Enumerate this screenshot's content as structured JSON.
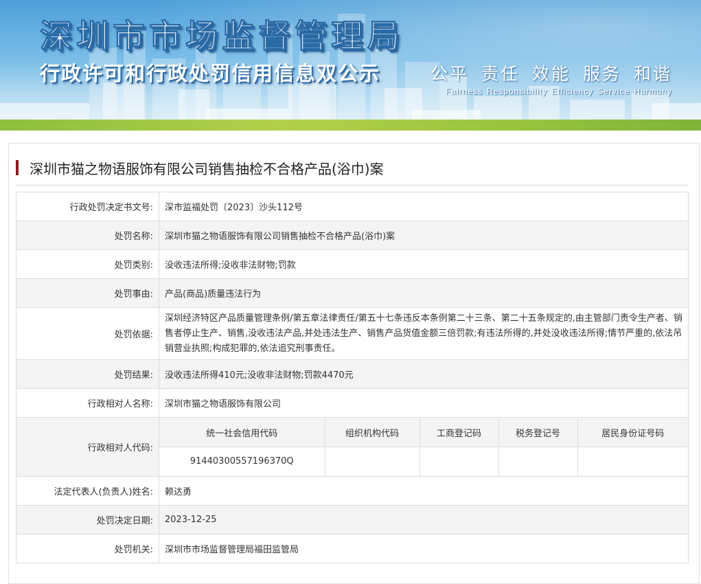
{
  "banner": {
    "title": "深圳市市场监督管理局",
    "subtitle": "行政许可和行政处罚信用信息双公示",
    "slogan_cn": [
      "公平",
      "责任",
      "效能",
      "服务",
      "和谐"
    ],
    "slogan_en": [
      "Fairness",
      "Responsibility",
      "Efficiency",
      "Service",
      "Harmony"
    ]
  },
  "case_title": "深圳市猫之物语服饰有限公司销售抽检不合格产品(浴巾)案",
  "fields": {
    "doc_no": {
      "label": "行政处罚决定书文号:",
      "value": "深市监福处罚〔2023〕沙头112号"
    },
    "name": {
      "label": "处罚名称:",
      "value": "深圳市猫之物语服饰有限公司销售抽检不合格产品(浴巾)案"
    },
    "category": {
      "label": "处罚类别:",
      "value": "没收违法所得;没收非法财物;罚款"
    },
    "reason": {
      "label": "处罚事由:",
      "value": "产品(商品)质量违法行为"
    },
    "basis": {
      "label": "处罚依据:",
      "value": "深圳经济特区产品质量管理条例/第五章法律责任/第五十七条违反本条例第二十三条、第二十五条规定的,由主管部门责令生产者、销售者停止生产、销售,没收违法产品,并处违法生产、销售产品货值金额三倍罚款;有违法所得的,并处没收违法所得;情节严重的,依法吊销营业执照;构成犯罪的,依法追究刑事责任。"
    },
    "result": {
      "label": "处罚结果:",
      "value": "没收违法所得410元;没收非法财物;罚款4470元"
    },
    "party_name": {
      "label": "行政相对人名称:",
      "value": "深圳市猫之物语服饰有限公司"
    },
    "party_code": {
      "label": "行政相对人代码:"
    },
    "legal_rep": {
      "label": "法定代表人(负责人)姓名:",
      "value": "赖达勇"
    },
    "decision_date": {
      "label": "处罚决定日期:",
      "value": "2023-12-25"
    },
    "authority": {
      "label": "处罚机关:",
      "value": "深圳市市场监督管理局福田监管局"
    }
  },
  "codes": {
    "headers": [
      "统一社会信用代码",
      "组织机构代码",
      "工商登记码",
      "税务登记号",
      "居民身份证号码"
    ],
    "values": [
      "91440300557196370Q",
      "",
      "",
      "",
      ""
    ]
  }
}
